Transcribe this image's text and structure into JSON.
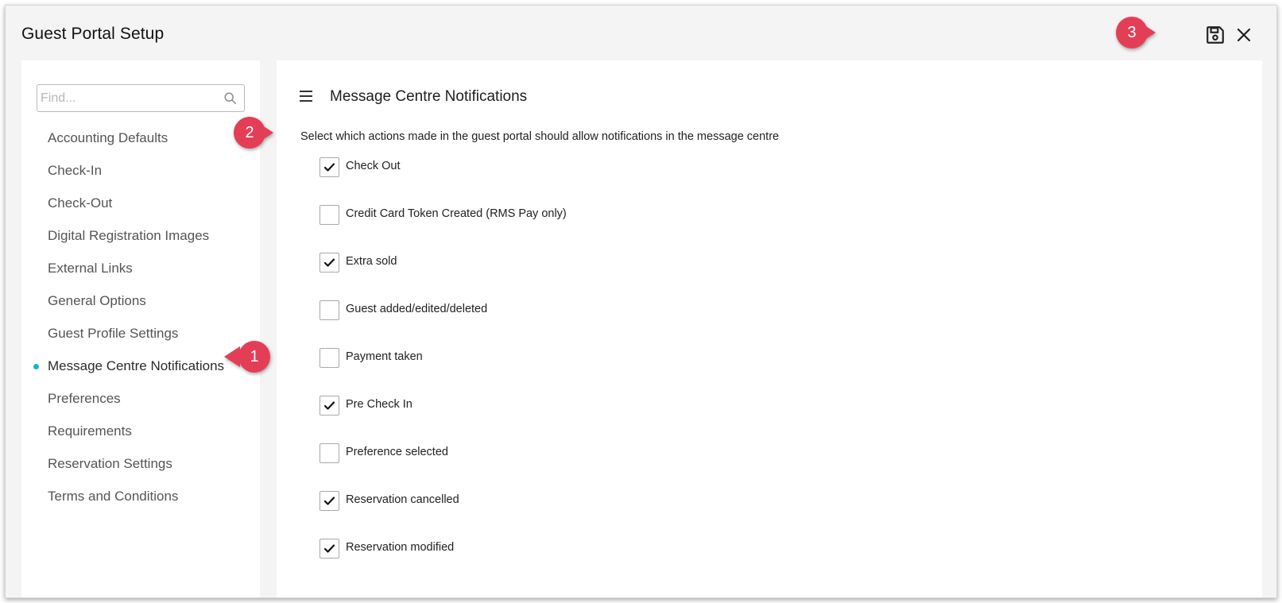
{
  "window": {
    "title": "Guest Portal Setup",
    "save_icon": "save-icon",
    "close_icon": "close-icon"
  },
  "sidebar": {
    "search_placeholder": "Find...",
    "search_icon": "search-icon",
    "items": [
      {
        "label": "Accounting Defaults",
        "active": false
      },
      {
        "label": "Check-In",
        "active": false
      },
      {
        "label": "Check-Out",
        "active": false
      },
      {
        "label": "Digital Registration Images",
        "active": false
      },
      {
        "label": "External Links",
        "active": false
      },
      {
        "label": "General Options",
        "active": false
      },
      {
        "label": "Guest Profile Settings",
        "active": false
      },
      {
        "label": "Message Centre Notifications",
        "active": true
      },
      {
        "label": "Preferences",
        "active": false
      },
      {
        "label": "Requirements",
        "active": false
      },
      {
        "label": "Reservation Settings",
        "active": false
      },
      {
        "label": "Terms and Conditions",
        "active": false
      }
    ],
    "active_color": "#1ab6c9"
  },
  "main": {
    "menu_icon": "hamburger-icon",
    "title": "Message Centre Notifications",
    "description": "Select which actions made in the guest portal should allow notifications in the message centre",
    "options": [
      {
        "label": "Check Out",
        "checked": true
      },
      {
        "label": "Credit Card Token Created (RMS Pay only)",
        "checked": false
      },
      {
        "label": "Extra sold",
        "checked": true
      },
      {
        "label": "Guest added/edited/deleted",
        "checked": false
      },
      {
        "label": "Payment taken",
        "checked": false
      },
      {
        "label": "Pre Check In",
        "checked": true
      },
      {
        "label": "Preference selected",
        "checked": false
      },
      {
        "label": "Reservation cancelled",
        "checked": true
      },
      {
        "label": "Reservation modified",
        "checked": true
      }
    ]
  },
  "callouts": [
    {
      "number": "1"
    },
    {
      "number": "2"
    },
    {
      "number": "3"
    }
  ],
  "colors": {
    "callout": "#e43e57",
    "active_dot": "#1ab6c9"
  }
}
